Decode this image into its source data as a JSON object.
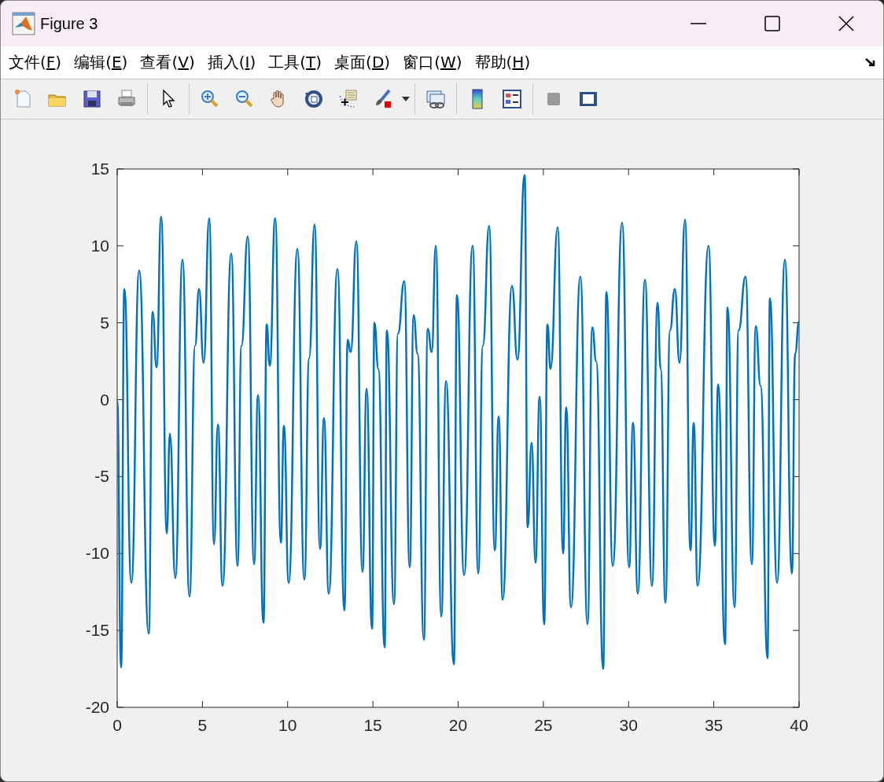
{
  "window": {
    "title": "Figure 3"
  },
  "menu": [
    {
      "label": "文件(",
      "access_key": "F",
      "end": ")"
    },
    {
      "label": "编辑(",
      "access_key": "E",
      "end": ")"
    },
    {
      "label": "查看(",
      "access_key": "V",
      "end": ")"
    },
    {
      "label": "插入(",
      "access_key": "I",
      "end": ")"
    },
    {
      "label": "工具(",
      "access_key": "T",
      "end": ")"
    },
    {
      "label": "桌面(",
      "access_key": "D",
      "end": ")"
    },
    {
      "label": "窗口(",
      "access_key": "W",
      "end": ")"
    },
    {
      "label": "帮助(",
      "access_key": "H",
      "end": ")"
    }
  ],
  "chart_data": {
    "type": "line",
    "xlim": [
      0,
      40
    ],
    "ylim": [
      -20,
      15
    ],
    "xticks": [
      0,
      5,
      10,
      15,
      20,
      25,
      30,
      35,
      40
    ],
    "yticks": [
      -20,
      -15,
      -10,
      -5,
      0,
      5,
      10,
      15
    ],
    "series": [
      {
        "color": "#0072bd",
        "x": [
          0,
          0.23,
          0.42,
          0.83,
          1.29,
          1.85,
          2.08,
          2.31,
          2.58,
          2.91,
          3.09,
          3.41,
          3.83,
          4.24,
          4.57,
          4.8,
          5.07,
          5.4,
          5.68,
          5.91,
          6.18,
          6.69,
          7.06,
          7.29,
          7.66,
          8.03,
          8.26,
          8.58,
          8.77,
          8.95,
          9.27,
          9.6,
          9.78,
          10.06,
          10.57,
          10.98,
          11.26,
          11.58,
          11.9,
          12.13,
          12.41,
          12.92,
          13.33,
          13.52,
          13.7,
          14.03,
          14.39,
          14.63,
          14.95,
          15.09,
          15.32,
          15.69,
          15.82,
          16.24,
          16.47,
          16.84,
          17.16,
          17.39,
          17.62,
          17.99,
          18.22,
          18.45,
          18.69,
          19.01,
          19.29,
          19.75,
          19.93,
          20.35,
          20.85,
          21.18,
          21.45,
          21.82,
          22.15,
          22.38,
          22.61,
          23.16,
          23.48,
          23.9,
          24.08,
          24.31,
          24.54,
          24.78,
          25.05,
          25.24,
          25.42,
          25.84,
          26.16,
          26.34,
          26.62,
          27.17,
          27.59,
          27.87,
          28.1,
          28.51,
          28.7,
          29.07,
          29.62,
          30.03,
          30.26,
          30.54,
          30.96,
          31.37,
          31.7,
          31.88,
          32.16,
          32.43,
          32.71,
          32.99,
          33.31,
          33.63,
          33.82,
          34.05,
          34.69,
          35.06,
          35.25,
          35.66,
          35.8,
          36.22,
          36.45,
          36.86,
          37.23,
          37.46,
          37.74,
          38.15,
          38.29,
          38.71,
          39.17,
          39.58,
          39.77,
          40
        ],
        "values": [
          0,
          -17.4,
          7.2,
          -11.9,
          8.4,
          -15.2,
          5.7,
          2.1,
          11.9,
          -8.7,
          -2.2,
          -11.6,
          9.1,
          -12.8,
          3.5,
          7.2,
          2.4,
          11.8,
          -9.4,
          -1.6,
          -12.1,
          9.5,
          -10.8,
          3.5,
          10.6,
          -10.7,
          0.3,
          -14.5,
          4.9,
          2.2,
          11.8,
          -9.3,
          -1.7,
          -11.9,
          9.8,
          -11.7,
          2.7,
          11.4,
          -9.7,
          -1.2,
          -12.6,
          8.5,
          -13.7,
          3.9,
          3.1,
          10.3,
          -11.2,
          0.7,
          -14.9,
          5,
          2,
          -16.1,
          4.5,
          -13.3,
          4.3,
          7.7,
          -10.9,
          5.5,
          3,
          -15.6,
          4.6,
          3.1,
          10,
          -14.1,
          1.2,
          -17.2,
          6.8,
          -11.4,
          10,
          -11.3,
          3.5,
          11.3,
          -9.8,
          -1.1,
          -13,
          7.4,
          2.6,
          14.6,
          -8.3,
          -2.8,
          -10.6,
          0.2,
          -14.6,
          4.9,
          2,
          11.2,
          -10,
          -0.5,
          -13.5,
          8,
          -14.6,
          4.7,
          2.5,
          -17.5,
          7,
          -10.8,
          11.5,
          -10.9,
          -1.5,
          -12.6,
          7.8,
          -12.1,
          6.3,
          2,
          -13.2,
          4.5,
          7.2,
          2.4,
          11.7,
          -9.8,
          -1.5,
          -12.1,
          10,
          -9.5,
          1,
          -15.9,
          6,
          -13.5,
          4.5,
          8,
          -10.7,
          4.8,
          0.9,
          -16.8,
          6.6,
          -11.9,
          9.1,
          -11.3,
          3,
          5.1
        ]
      }
    ]
  }
}
